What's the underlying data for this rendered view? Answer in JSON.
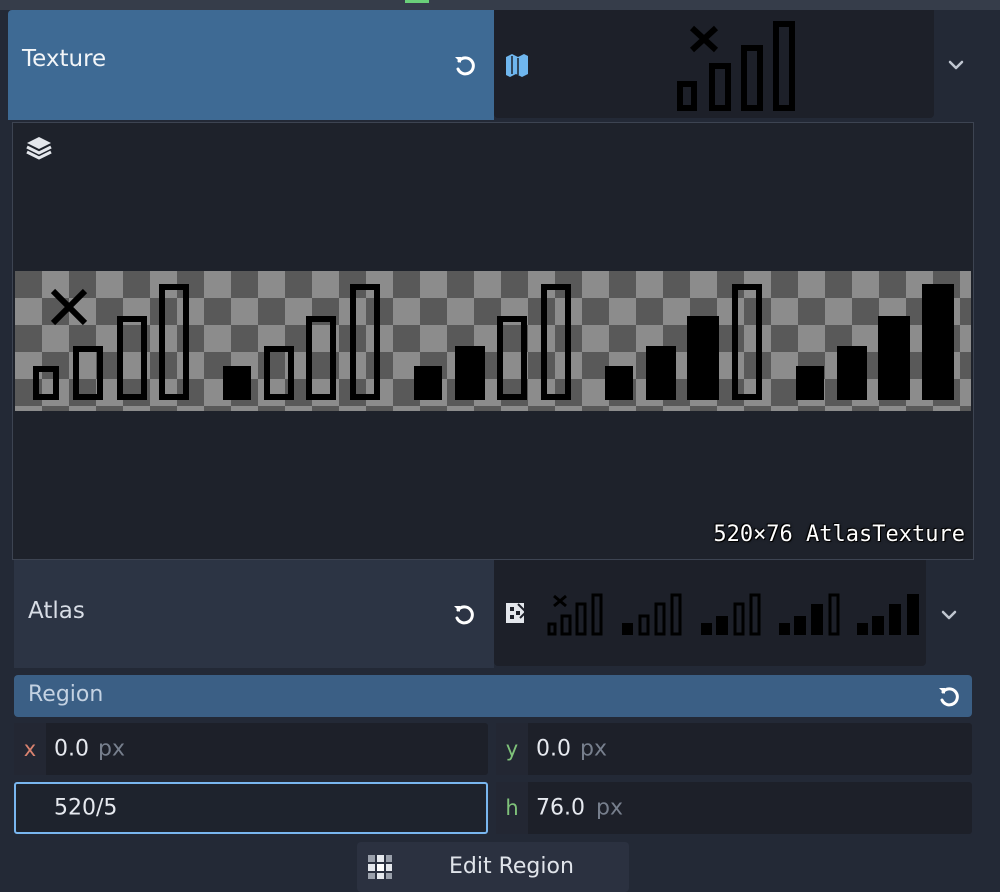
{
  "texture": {
    "label": "Texture",
    "revert_icon": "revert-icon",
    "type_icon": "map-icon",
    "dropdown_icon": "chevron-down-icon"
  },
  "preview": {
    "layers_icon": "layers-icon",
    "caption": "520×76 AtlasTexture"
  },
  "atlas": {
    "label": "Atlas",
    "revert_icon": "revert-icon",
    "type_icon": "image-texture-icon",
    "dropdown_icon": "chevron-down-icon"
  },
  "region": {
    "label": "Region",
    "revert_icon": "revert-icon",
    "x": {
      "axis": "x",
      "value": "0.0",
      "unit": "px"
    },
    "y": {
      "axis": "y",
      "value": "0.0",
      "unit": "px"
    },
    "w": {
      "value": "520/5"
    },
    "h": {
      "axis": "h",
      "value": "76.0",
      "unit": "px"
    }
  },
  "edit_region": {
    "label": "Edit Region",
    "icon": "grid-icon"
  },
  "colors": {
    "header_blue": "#3e6a94",
    "region_blue": "#3b5f85",
    "focus_border": "#79b6ef",
    "axis_x": "#d9826f",
    "axis_y": "#7fc27a",
    "axis_h": "#7fc27a"
  }
}
